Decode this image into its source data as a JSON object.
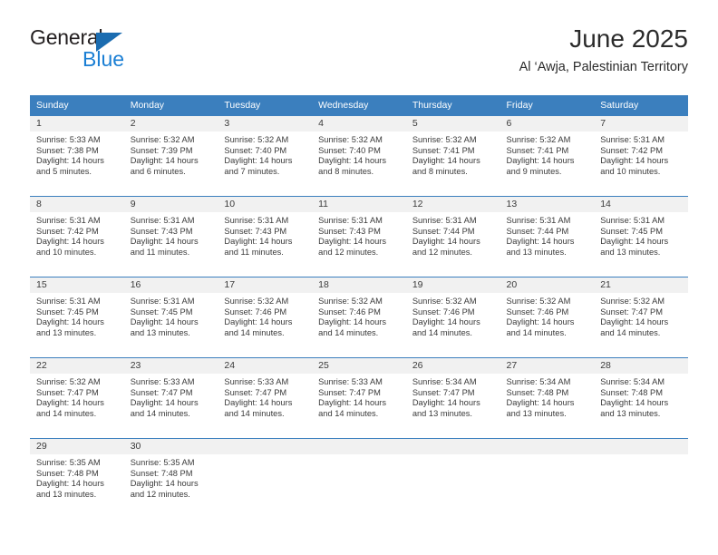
{
  "logo": {
    "word1": "General",
    "word2": "Blue",
    "triangle_color": "#1b6cb0",
    "word2_color": "#1b7fd4"
  },
  "header": {
    "title": "June 2025",
    "subtitle": "Al ‘Awja, Palestinian Territory"
  },
  "theme": {
    "header_bg": "#3b7fbe",
    "header_text": "#ffffff",
    "daynum_bg": "#f1f1f1",
    "row_border": "#3b7fbe",
    "text": "#3a3a3a"
  },
  "weekday_headers": [
    "Sunday",
    "Monday",
    "Tuesday",
    "Wednesday",
    "Thursday",
    "Friday",
    "Saturday"
  ],
  "weeks": [
    [
      {
        "day": "1",
        "sunrise": "Sunrise: 5:33 AM",
        "sunset": "Sunset: 7:38 PM",
        "daylight": "Daylight: 14 hours and 5 minutes."
      },
      {
        "day": "2",
        "sunrise": "Sunrise: 5:32 AM",
        "sunset": "Sunset: 7:39 PM",
        "daylight": "Daylight: 14 hours and 6 minutes."
      },
      {
        "day": "3",
        "sunrise": "Sunrise: 5:32 AM",
        "sunset": "Sunset: 7:40 PM",
        "daylight": "Daylight: 14 hours and 7 minutes."
      },
      {
        "day": "4",
        "sunrise": "Sunrise: 5:32 AM",
        "sunset": "Sunset: 7:40 PM",
        "daylight": "Daylight: 14 hours and 8 minutes."
      },
      {
        "day": "5",
        "sunrise": "Sunrise: 5:32 AM",
        "sunset": "Sunset: 7:41 PM",
        "daylight": "Daylight: 14 hours and 8 minutes."
      },
      {
        "day": "6",
        "sunrise": "Sunrise: 5:32 AM",
        "sunset": "Sunset: 7:41 PM",
        "daylight": "Daylight: 14 hours and 9 minutes."
      },
      {
        "day": "7",
        "sunrise": "Sunrise: 5:31 AM",
        "sunset": "Sunset: 7:42 PM",
        "daylight": "Daylight: 14 hours and 10 minutes."
      }
    ],
    [
      {
        "day": "8",
        "sunrise": "Sunrise: 5:31 AM",
        "sunset": "Sunset: 7:42 PM",
        "daylight": "Daylight: 14 hours and 10 minutes."
      },
      {
        "day": "9",
        "sunrise": "Sunrise: 5:31 AM",
        "sunset": "Sunset: 7:43 PM",
        "daylight": "Daylight: 14 hours and 11 minutes."
      },
      {
        "day": "10",
        "sunrise": "Sunrise: 5:31 AM",
        "sunset": "Sunset: 7:43 PM",
        "daylight": "Daylight: 14 hours and 11 minutes."
      },
      {
        "day": "11",
        "sunrise": "Sunrise: 5:31 AM",
        "sunset": "Sunset: 7:43 PM",
        "daylight": "Daylight: 14 hours and 12 minutes."
      },
      {
        "day": "12",
        "sunrise": "Sunrise: 5:31 AM",
        "sunset": "Sunset: 7:44 PM",
        "daylight": "Daylight: 14 hours and 12 minutes."
      },
      {
        "day": "13",
        "sunrise": "Sunrise: 5:31 AM",
        "sunset": "Sunset: 7:44 PM",
        "daylight": "Daylight: 14 hours and 13 minutes."
      },
      {
        "day": "14",
        "sunrise": "Sunrise: 5:31 AM",
        "sunset": "Sunset: 7:45 PM",
        "daylight": "Daylight: 14 hours and 13 minutes."
      }
    ],
    [
      {
        "day": "15",
        "sunrise": "Sunrise: 5:31 AM",
        "sunset": "Sunset: 7:45 PM",
        "daylight": "Daylight: 14 hours and 13 minutes."
      },
      {
        "day": "16",
        "sunrise": "Sunrise: 5:31 AM",
        "sunset": "Sunset: 7:45 PM",
        "daylight": "Daylight: 14 hours and 13 minutes."
      },
      {
        "day": "17",
        "sunrise": "Sunrise: 5:32 AM",
        "sunset": "Sunset: 7:46 PM",
        "daylight": "Daylight: 14 hours and 14 minutes."
      },
      {
        "day": "18",
        "sunrise": "Sunrise: 5:32 AM",
        "sunset": "Sunset: 7:46 PM",
        "daylight": "Daylight: 14 hours and 14 minutes."
      },
      {
        "day": "19",
        "sunrise": "Sunrise: 5:32 AM",
        "sunset": "Sunset: 7:46 PM",
        "daylight": "Daylight: 14 hours and 14 minutes."
      },
      {
        "day": "20",
        "sunrise": "Sunrise: 5:32 AM",
        "sunset": "Sunset: 7:46 PM",
        "daylight": "Daylight: 14 hours and 14 minutes."
      },
      {
        "day": "21",
        "sunrise": "Sunrise: 5:32 AM",
        "sunset": "Sunset: 7:47 PM",
        "daylight": "Daylight: 14 hours and 14 minutes."
      }
    ],
    [
      {
        "day": "22",
        "sunrise": "Sunrise: 5:32 AM",
        "sunset": "Sunset: 7:47 PM",
        "daylight": "Daylight: 14 hours and 14 minutes."
      },
      {
        "day": "23",
        "sunrise": "Sunrise: 5:33 AM",
        "sunset": "Sunset: 7:47 PM",
        "daylight": "Daylight: 14 hours and 14 minutes."
      },
      {
        "day": "24",
        "sunrise": "Sunrise: 5:33 AM",
        "sunset": "Sunset: 7:47 PM",
        "daylight": "Daylight: 14 hours and 14 minutes."
      },
      {
        "day": "25",
        "sunrise": "Sunrise: 5:33 AM",
        "sunset": "Sunset: 7:47 PM",
        "daylight": "Daylight: 14 hours and 14 minutes."
      },
      {
        "day": "26",
        "sunrise": "Sunrise: 5:34 AM",
        "sunset": "Sunset: 7:47 PM",
        "daylight": "Daylight: 14 hours and 13 minutes."
      },
      {
        "day": "27",
        "sunrise": "Sunrise: 5:34 AM",
        "sunset": "Sunset: 7:48 PM",
        "daylight": "Daylight: 14 hours and 13 minutes."
      },
      {
        "day": "28",
        "sunrise": "Sunrise: 5:34 AM",
        "sunset": "Sunset: 7:48 PM",
        "daylight": "Daylight: 14 hours and 13 minutes."
      }
    ],
    [
      {
        "day": "29",
        "sunrise": "Sunrise: 5:35 AM",
        "sunset": "Sunset: 7:48 PM",
        "daylight": "Daylight: 14 hours and 13 minutes."
      },
      {
        "day": "30",
        "sunrise": "Sunrise: 5:35 AM",
        "sunset": "Sunset: 7:48 PM",
        "daylight": "Daylight: 14 hours and 12 minutes."
      },
      {
        "day": "",
        "sunrise": "",
        "sunset": "",
        "daylight": ""
      },
      {
        "day": "",
        "sunrise": "",
        "sunset": "",
        "daylight": ""
      },
      {
        "day": "",
        "sunrise": "",
        "sunset": "",
        "daylight": ""
      },
      {
        "day": "",
        "sunrise": "",
        "sunset": "",
        "daylight": ""
      },
      {
        "day": "",
        "sunrise": "",
        "sunset": "",
        "daylight": ""
      }
    ]
  ]
}
